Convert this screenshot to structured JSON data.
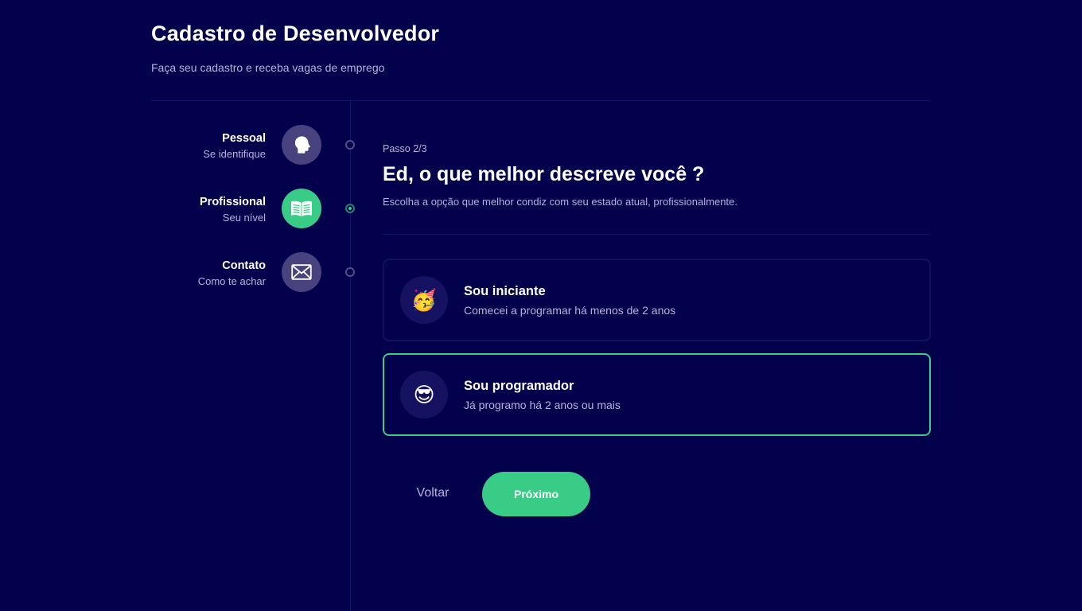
{
  "header": {
    "title": "Cadastro de Desenvolvedor",
    "subtitle": "Faça seu cadastro e receba vagas de emprego"
  },
  "steps": [
    {
      "title": "Pessoal",
      "subtitle": "Se identifique",
      "icon": "head-icon",
      "status": "done"
    },
    {
      "title": "Profissional",
      "subtitle": "Seu nível",
      "icon": "book-icon",
      "status": "active"
    },
    {
      "title": "Contato",
      "subtitle": "Como te achar",
      "icon": "mail-icon",
      "status": "pending"
    }
  ],
  "content": {
    "step_label": "Passo 2/3",
    "question": "Ed, o que melhor descreve você ?",
    "hint": "Escolha a opção que melhor condiz com seu estado atual, profissionalmente."
  },
  "options": [
    {
      "emoji": "🥳",
      "icon": "party-face-icon",
      "title": "Sou iniciante",
      "subtitle": "Comecei a programar há menos de 2 anos",
      "selected": false
    },
    {
      "emoji": "😎",
      "icon": "sunglasses-face-icon",
      "title": "Sou programador",
      "subtitle": "Já programo há 2 anos ou mais",
      "selected": true
    }
  ],
  "buttons": {
    "back": "Voltar",
    "next": "Próximo"
  },
  "colors": {
    "background": "#03014c",
    "accent": "#38cc86",
    "muted_text": "#b6b2d9",
    "step_icon_bg": "#48427e"
  }
}
